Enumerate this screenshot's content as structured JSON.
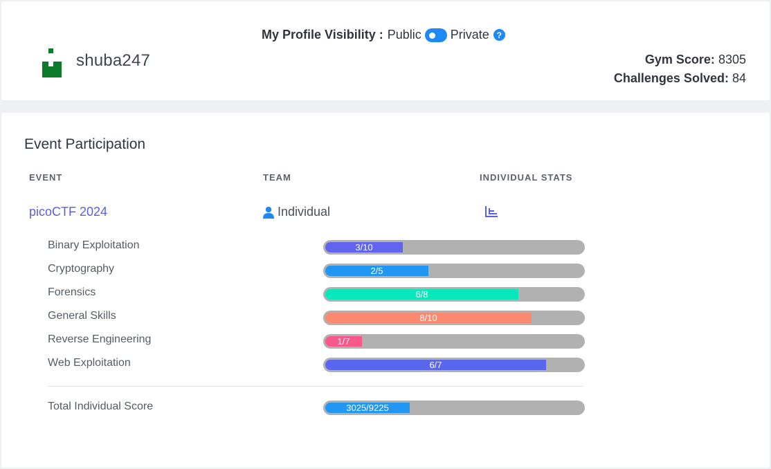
{
  "profile": {
    "username": "shuba247",
    "visibility_label": "My Profile Visibility :",
    "public_label": "Public",
    "private_label": "Private",
    "help_symbol": "?",
    "gym_score_label": "Gym Score:",
    "gym_score_value": "8305",
    "challenges_label": "Challenges Solved:",
    "challenges_value": "84",
    "avatar_color": "#0b7a2a",
    "toggle_color": "#1e88f5"
  },
  "events": {
    "title": "Event Participation",
    "columns": {
      "event": "EVENT",
      "team": "TEAM",
      "stats": "INDIVIDUAL STATS"
    },
    "rows": [
      {
        "name": "picoCTF 2024",
        "team": "Individual",
        "team_icon": "person-icon",
        "stats_icon": "bar-chart-icon",
        "categories": [
          {
            "label": "Binary Exploitation",
            "text": "3/10",
            "solved": 3,
            "total": 10,
            "color": "#6064ef"
          },
          {
            "label": "Cryptography",
            "text": "2/5",
            "solved": 2,
            "total": 5,
            "color": "#2196f3"
          },
          {
            "label": "Forensics",
            "text": "6/8",
            "solved": 6,
            "total": 8,
            "color": "#07e8bd"
          },
          {
            "label": "General Skills",
            "text": "8/10",
            "solved": 8,
            "total": 10,
            "color": "#fb8a70"
          },
          {
            "label": "Reverse Engineering",
            "text": "1/7",
            "solved": 1,
            "total": 7,
            "color": "#f9588b"
          },
          {
            "label": "Web Exploitation",
            "text": "6/7",
            "solved": 6,
            "total": 7,
            "color": "#5b66ee"
          }
        ],
        "total": {
          "label": "Total Individual Score",
          "text": "3025/9225",
          "solved": 3025,
          "total": 9225,
          "color": "#2196f3"
        }
      }
    ]
  }
}
